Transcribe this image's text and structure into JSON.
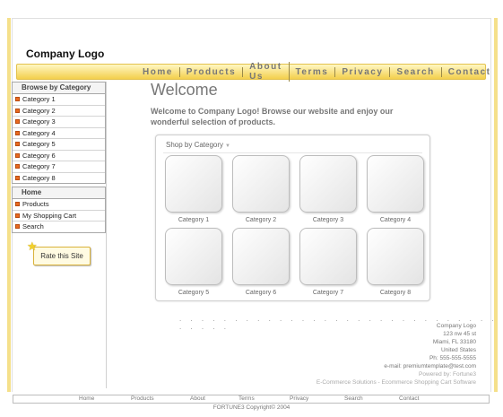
{
  "header": {
    "logo": "Company Logo"
  },
  "nav": [
    "Home",
    "Products",
    "About Us",
    "Terms",
    "Privacy",
    "Search",
    "Contact"
  ],
  "sidebar": {
    "browse_title": "Browse by Category",
    "categories": [
      "Category 1",
      "Category 2",
      "Category 3",
      "Category 4",
      "Category 5",
      "Category 6",
      "Category 7",
      "Category 8"
    ],
    "home_title": "Home",
    "links": [
      "Products",
      "My Shopping Cart",
      "Search"
    ],
    "rate": "Rate this Site"
  },
  "main": {
    "title": "Welcome",
    "intro": "Welcome to  Company Logo! Browse our website and enjoy our wonderful selection of products.",
    "shop_title": "Shop by Category",
    "categories": [
      "Category 1",
      "Category 2",
      "Category 3",
      "Category 4",
      "Category 5",
      "Category 6",
      "Category 7",
      "Category 8"
    ],
    "dots": ". . . . . . . . . . . . . . . . . . . . . . . . . . . . . . . . . ."
  },
  "address": {
    "company": "Company Logo",
    "street": "123 nw 45 st",
    "city": "Miami, FL 33180",
    "country": "United States",
    "phone": "Ph: 555-555-5555",
    "email": "e-mail: premiumtemplate@test.com",
    "powered": "Powered by: Fortune3",
    "solutions": "E-Commerce Solutions - Ecommerce Shopping Cart Software"
  },
  "footer": {
    "links": [
      "Home",
      "Products",
      "About",
      "Terms",
      "Privacy",
      "Search",
      "Contact"
    ],
    "copyright": "FORTUNE3 Copyright© 2004"
  },
  "colors": {
    "accent": "#f3cf4c",
    "bullet": "#e96a1f",
    "text_gray": "#777777"
  }
}
